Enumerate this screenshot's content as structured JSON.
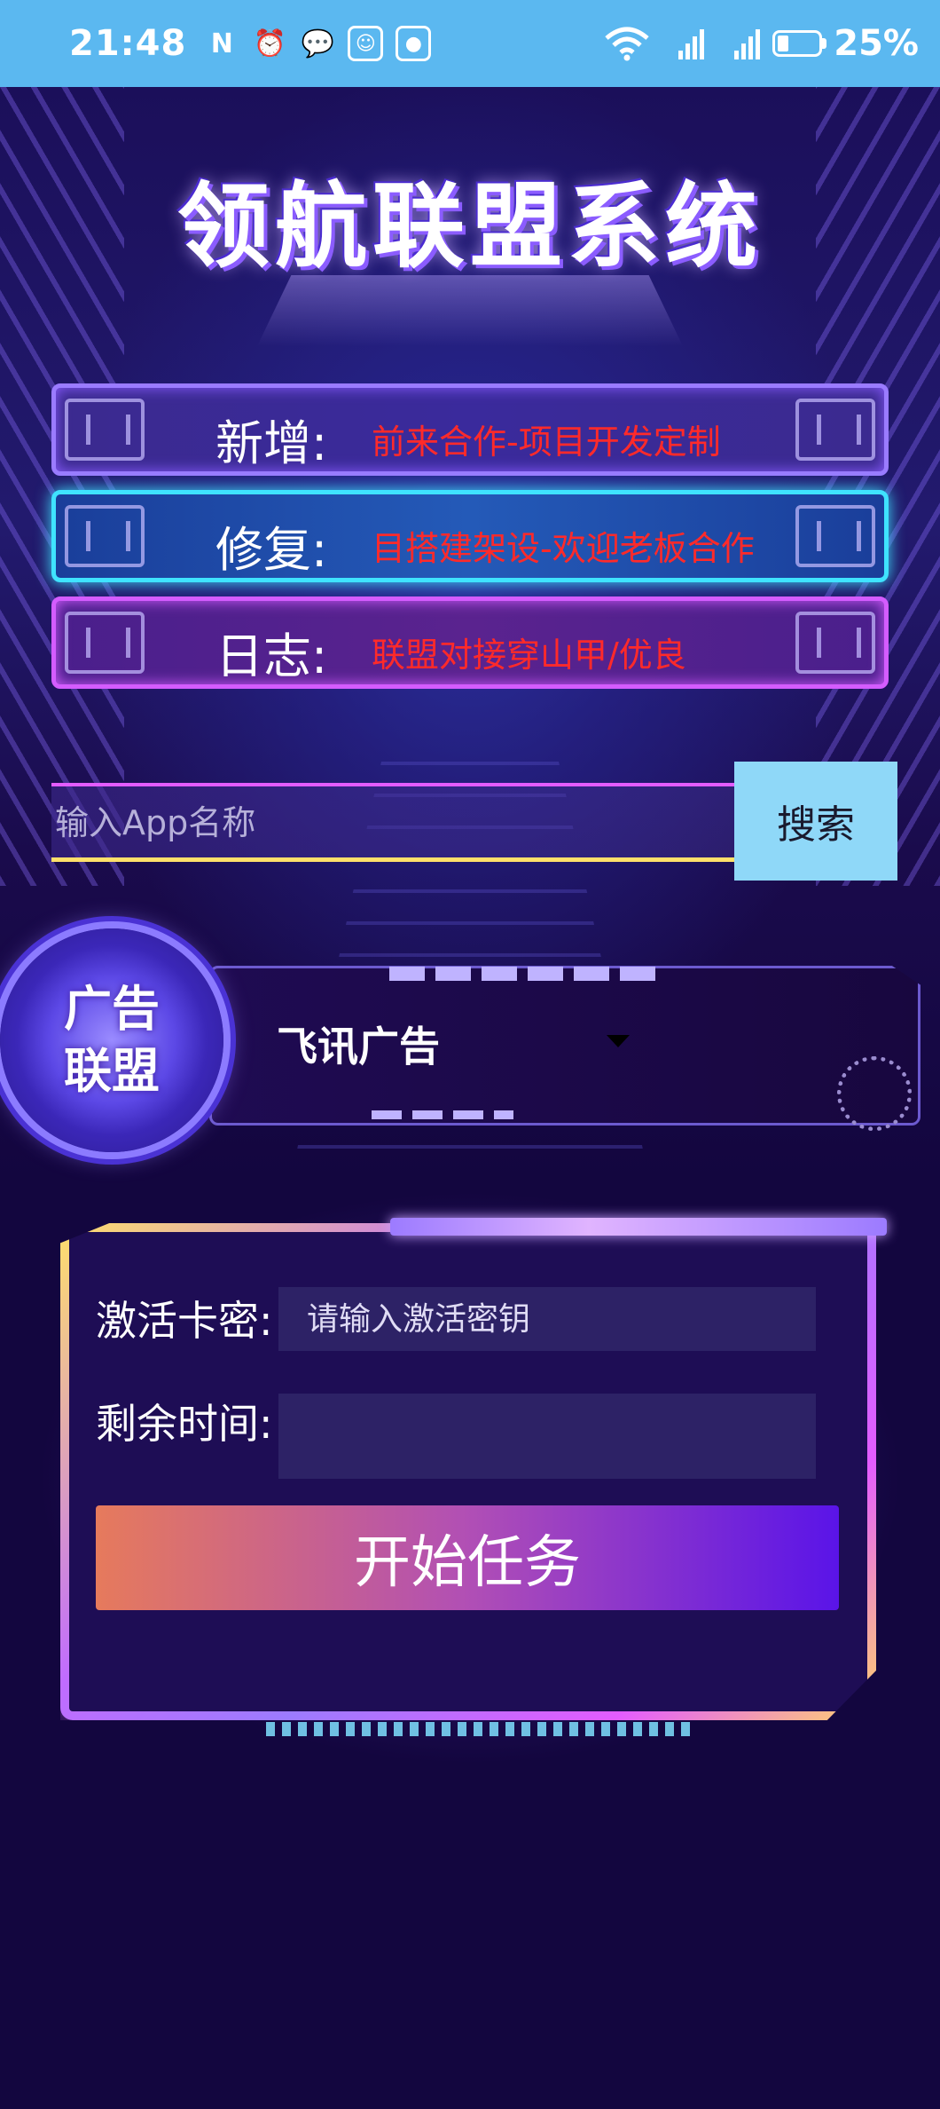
{
  "status_bar": {
    "time": "21:48",
    "icons": [
      "nfc-icon",
      "alarm-icon",
      "wechat-icon",
      "app-icon",
      "browser-icon"
    ],
    "wifi_label": "6",
    "signal1_label": "5G",
    "signal2_label": "5G",
    "battery": "25%"
  },
  "app": {
    "title": "领航联盟系统"
  },
  "notices": [
    {
      "label": "新增:",
      "text": "前来合作-项目开发定制"
    },
    {
      "label": "修复:",
      "text": "目搭建架设-欢迎老板合作"
    },
    {
      "label": "日志:",
      "text": "联盟对接穿山甲/优良"
    }
  ],
  "search": {
    "placeholder": "输入App名称",
    "button": "搜索"
  },
  "ad": {
    "badge_line1": "广告",
    "badge_line2": "联盟",
    "selected": "飞讯广告"
  },
  "task": {
    "key_label": "激活卡密:",
    "key_placeholder": "请输入激活密钥",
    "time_label": "剩余时间:",
    "time_value": "",
    "start_button": "开始任务"
  },
  "colors": {
    "status_bar": "#5bb8f0",
    "background": "#13063f",
    "ticker_text": "#ff2a2a",
    "search_button": "#8fd8f8"
  }
}
